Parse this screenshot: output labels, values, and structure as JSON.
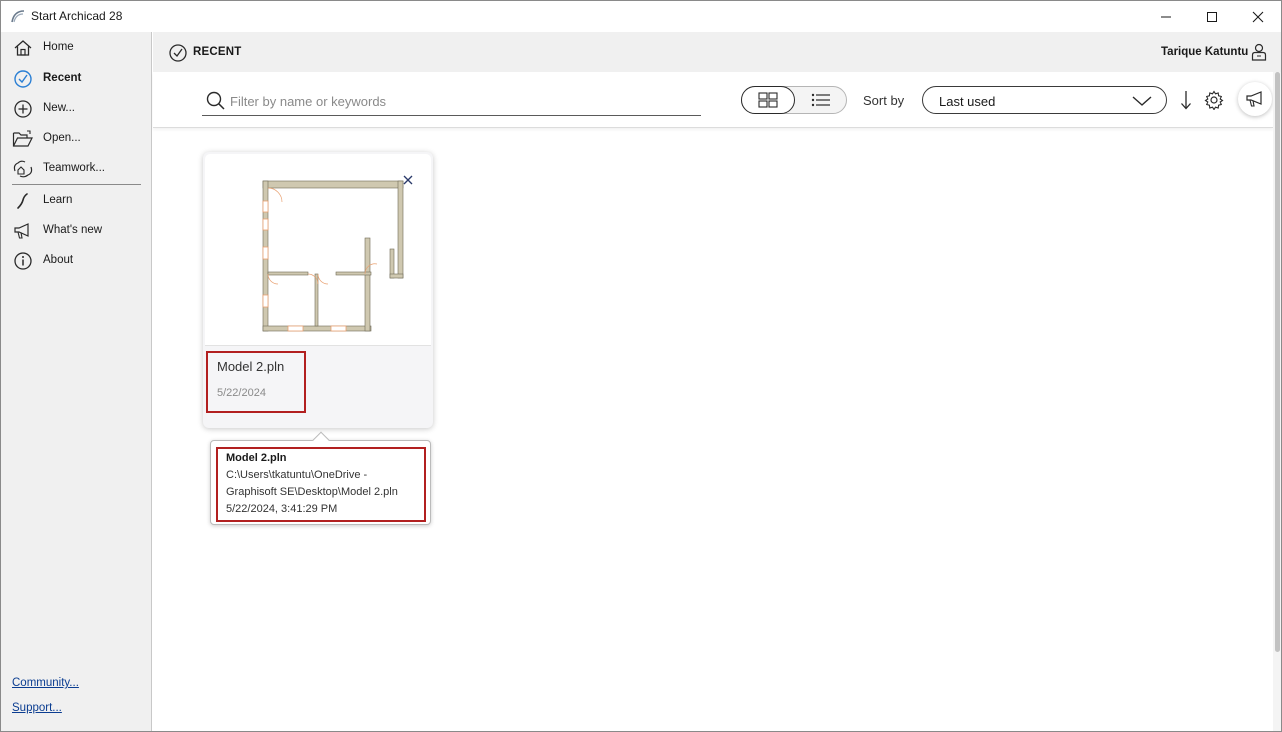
{
  "window": {
    "title": "Start Archicad 28"
  },
  "sidebar": {
    "items": [
      {
        "label": "Home",
        "icon": "home-icon"
      },
      {
        "label": "Recent",
        "icon": "clock-icon",
        "active": true
      },
      {
        "label": "New...",
        "icon": "plus-circle-icon"
      },
      {
        "label": "Open...",
        "icon": "folder-open-icon"
      },
      {
        "label": "Teamwork...",
        "icon": "teamwork-icon"
      },
      {
        "label": "Learn",
        "icon": "learn-icon"
      },
      {
        "label": "What's new",
        "icon": "megaphone-icon"
      },
      {
        "label": "About",
        "icon": "info-icon"
      }
    ],
    "links": {
      "community": "Community...",
      "support": "Support..."
    }
  },
  "header": {
    "section": "RECENT",
    "user": "Tarique Katuntu"
  },
  "toolbar": {
    "search_placeholder": "Filter by name or keywords",
    "sort_label": "Sort by",
    "sort_value": "Last used"
  },
  "card": {
    "name": "Model 2.pln",
    "date": "5/22/2024"
  },
  "tooltip": {
    "name": "Model 2.pln",
    "path_line1": "C:\\Users\\tkatuntu\\OneDrive -",
    "path_line2": "Graphisoft SE\\Desktop\\Model 2.pln",
    "datetime": "5/22/2024, 3:41:29 PM"
  },
  "colors": {
    "highlight": "#b22020",
    "link": "#0b3d91",
    "sidebar_bg": "#f0f0f0",
    "wall": "#cfc8b0"
  }
}
